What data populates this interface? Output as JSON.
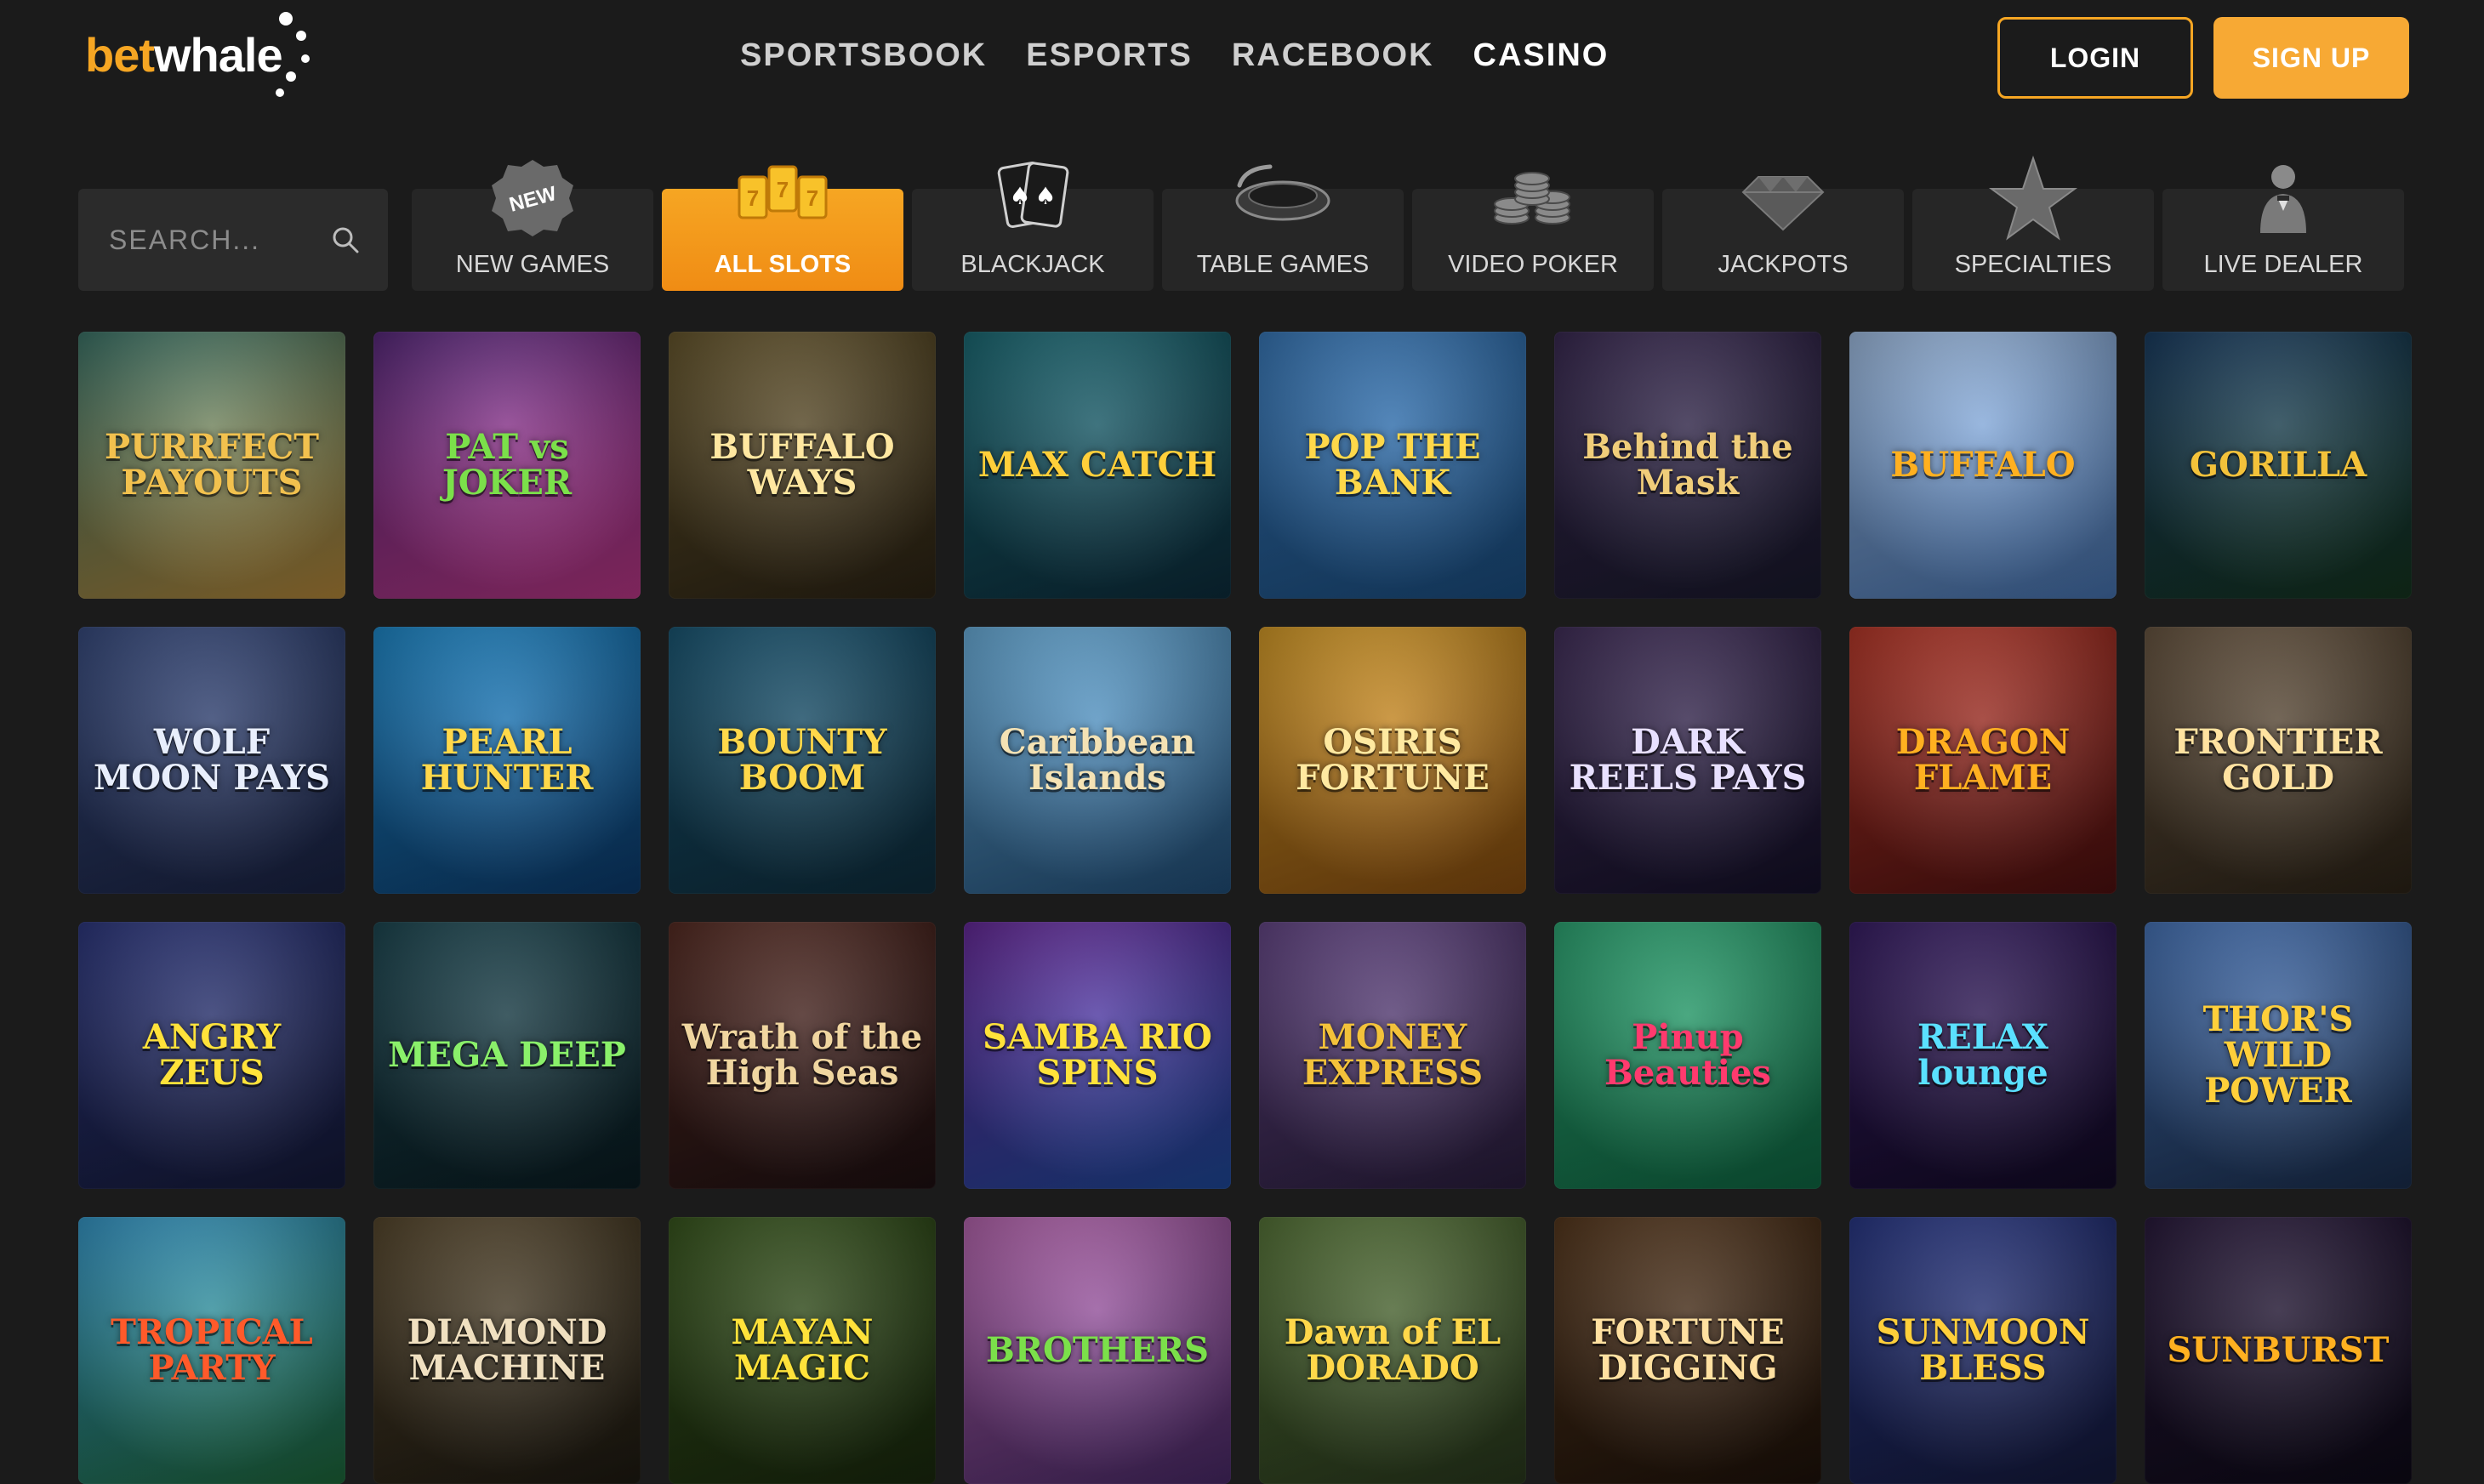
{
  "header": {
    "logo": {
      "bet": "bet",
      "whale": "whale"
    },
    "nav": [
      "SPORTSBOOK",
      "ESPORTS",
      "RACEBOOK",
      "CASINO"
    ],
    "active_nav": "CASINO",
    "login_label": "LOGIN",
    "signup_label": "SIGN UP",
    "accent_color": "#f6a623"
  },
  "search": {
    "placeholder": "SEARCH..."
  },
  "categories": [
    {
      "label": "NEW GAMES",
      "icon": "new-badge-icon",
      "badge": "NEW"
    },
    {
      "label": "ALL SLOTS",
      "icon": "slot-reels-icon",
      "active": true
    },
    {
      "label": "BLACKJACK",
      "icon": "cards-icon"
    },
    {
      "label": "TABLE GAMES",
      "icon": "roulette-icon"
    },
    {
      "label": "VIDEO POKER",
      "icon": "chips-icon"
    },
    {
      "label": "JACKPOTS",
      "icon": "diamond-icon"
    },
    {
      "label": "SPECIALTIES",
      "icon": "star-icon"
    },
    {
      "label": "LIVE DEALER",
      "icon": "dealer-icon"
    }
  ],
  "games": [
    {
      "title": "PURRFECT PAYOUTS",
      "color1": "#3e7a6e",
      "color2": "#b98a3a",
      "text": "#f2c14e"
    },
    {
      "title": "PAT vs JOKER",
      "color1": "#5b2a82",
      "color2": "#c0398a",
      "text": "#7be04a"
    },
    {
      "title": "BUFFALO WAYS",
      "color1": "#6b5a2e",
      "color2": "#2d2415",
      "text": "#ffe7a0"
    },
    {
      "title": "MAX CATCH",
      "color1": "#1b6f7a",
      "color2": "#0d2d3d",
      "text": "#ffcf3a"
    },
    {
      "title": "POP THE BANK",
      "color1": "#3a7ec2",
      "color2": "#1b4f83",
      "text": "#ffd84a"
    },
    {
      "title": "Behind the Mask",
      "color1": "#3b2a55",
      "color2": "#1a1a2e",
      "text": "#f0cd7a"
    },
    {
      "title": "BUFFALO",
      "color1": "#a9c8ef",
      "color2": "#4674b3",
      "text": "#ffb020"
    },
    {
      "title": "GORILLA",
      "color1": "#1a3f66",
      "color2": "#15361f",
      "text": "#f3c23a"
    },
    {
      "title": "WOLF MOON PAYS",
      "color1": "#3a4f86",
      "color2": "#1a2344",
      "text": "#e8eefc"
    },
    {
      "title": "PEARL HUNTER",
      "color1": "#1e8fd4",
      "color2": "#0c3b6e",
      "text": "#ffd84a"
    },
    {
      "title": "BOUNTY BOOM",
      "color1": "#1a5b7a",
      "color2": "#0f2e3e",
      "text": "#ffd84a"
    },
    {
      "title": "Caribbean Islands",
      "color1": "#6fb8e8",
      "color2": "#214f7a",
      "text": "#f4e2b4"
    },
    {
      "title": "OSIRIS FORTUNE",
      "color1": "#e2a429",
      "color2": "#8a4e10",
      "text": "#ffe9a0"
    },
    {
      "title": "DARK REELS PAYS",
      "color1": "#44305e",
      "color2": "#15112a",
      "text": "#e8e0ff"
    },
    {
      "title": "DRAGON FLAME",
      "color1": "#c23a2a",
      "color2": "#4f1010",
      "text": "#ffb020"
    },
    {
      "title": "FRONTIER GOLD",
      "color1": "#6e5a44",
      "color2": "#2d2418",
      "text": "#ffe2a0"
    },
    {
      "title": "ANGRY ZEUS",
      "color1": "#2f3a86",
      "color2": "#151a3a",
      "text": "#ffe23a"
    },
    {
      "title": "MEGA DEEP",
      "color1": "#1d4a55",
      "color2": "#0a1c22",
      "text": "#8af06a"
    },
    {
      "title": "Wrath of the High Seas",
      "color1": "#5a2d24",
      "color2": "#1e1012",
      "text": "#f0d6a0"
    },
    {
      "title": "SAMBA RIO SPINS",
      "color1": "#6a2aa0",
      "color2": "#1e4b9e",
      "text": "#ffe23a"
    },
    {
      "title": "MONEY EXPRESS",
      "color1": "#6a4a8e",
      "color2": "#2a1e3e",
      "text": "#f3c23a"
    },
    {
      "title": "Pinup Beauties",
      "color1": "#2fb07a",
      "color2": "#0f6a44",
      "text": "#ff3a6e"
    },
    {
      "title": "RELAX lounge",
      "color1": "#3a1e6a",
      "color2": "#120a26",
      "text": "#5ae0ff"
    },
    {
      "title": "THOR'S WILD POWER",
      "color1": "#4a7ac2",
      "color2": "#1a2e4e",
      "text": "#ffcf3a"
    },
    {
      "title": "TROPICAL PARTY",
      "color1": "#38a0d4",
      "color2": "#1e6a3a",
      "text": "#ff5a2a"
    },
    {
      "title": "DIAMOND MACHINE",
      "color1": "#5a4a2e",
      "color2": "#1e1a12",
      "text": "#f0e0c0"
    },
    {
      "title": "MAYAN MAGIC",
      "color1": "#3a5a1e",
      "color2": "#1a2a0e",
      "text": "#ffe23a"
    },
    {
      "title": "BROTHERS",
      "color1": "#c06ab8",
      "color2": "#4a2a6a",
      "text": "#7be04a"
    },
    {
      "title": "Dawn of EL DORADO",
      "color1": "#5a7a3a",
      "color2": "#2a3a1e",
      "text": "#ffd84a"
    },
    {
      "title": "FORTUNE DIGGING",
      "color1": "#5a3a1e",
      "color2": "#1e120a",
      "text": "#ffe0a0"
    },
    {
      "title": "SUNMOON BLESS",
      "color1": "#2a3a8e",
      "color2": "#151a3e",
      "text": "#ffcf3a"
    },
    {
      "title": "SUNBURST",
      "color1": "#2a1a3e",
      "color2": "#0e0a18",
      "text": "#ffb020"
    }
  ]
}
